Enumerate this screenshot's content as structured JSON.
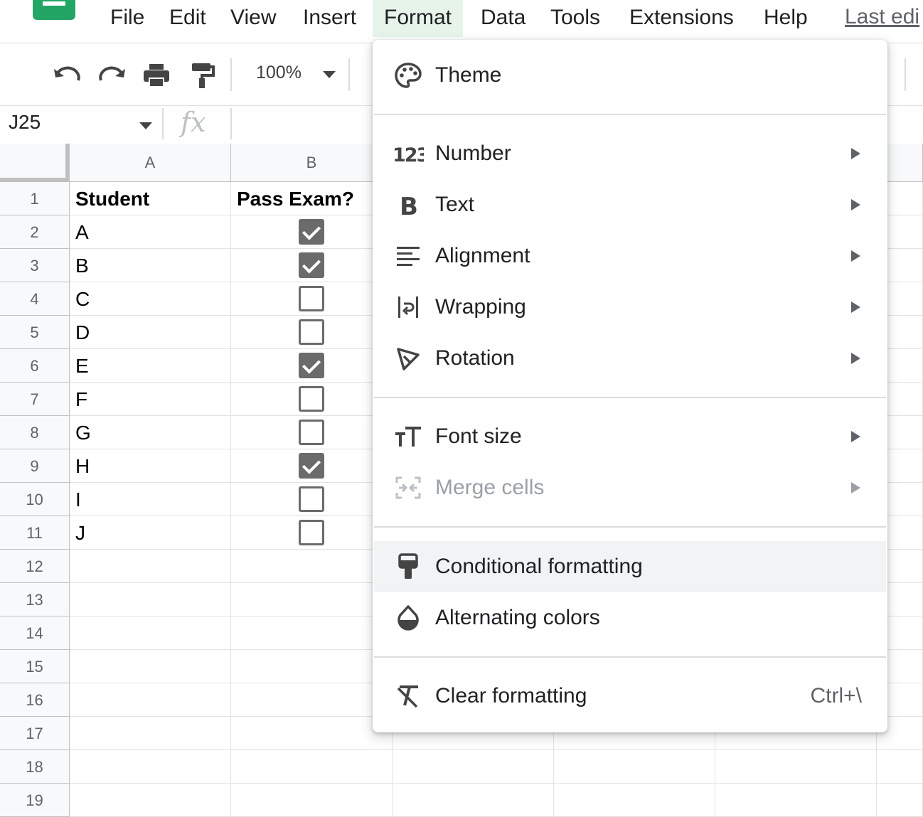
{
  "menubar": {
    "items": [
      "File",
      "Edit",
      "View",
      "Insert",
      "Format",
      "Data",
      "Tools",
      "Extensions",
      "Help"
    ],
    "active": "Format",
    "last_edit": "Last edi"
  },
  "toolbar": {
    "zoom": "100%",
    "icons": [
      "undo-icon",
      "redo-icon",
      "print-icon",
      "paint-format-icon",
      "chevron-down-icon"
    ]
  },
  "formula_bar": {
    "cell_ref": "J25",
    "fx_label": "fx",
    "value": ""
  },
  "sheet": {
    "columns": [
      "A",
      "B"
    ],
    "row_numbers": [
      "1",
      "2",
      "3",
      "4",
      "5",
      "6",
      "7",
      "8",
      "9",
      "10",
      "11",
      "12",
      "13",
      "14",
      "15",
      "16",
      "17",
      "18",
      "19"
    ],
    "header_row": [
      "Student",
      "Pass Exam?"
    ],
    "rows": [
      {
        "student": "A",
        "pass": true
      },
      {
        "student": "B",
        "pass": true
      },
      {
        "student": "C",
        "pass": false
      },
      {
        "student": "D",
        "pass": false
      },
      {
        "student": "E",
        "pass": true
      },
      {
        "student": "F",
        "pass": false
      },
      {
        "student": "G",
        "pass": false
      },
      {
        "student": "H",
        "pass": true
      },
      {
        "student": "I",
        "pass": false
      },
      {
        "student": "J",
        "pass": false
      }
    ]
  },
  "format_menu": {
    "items": [
      {
        "label": "Theme",
        "icon": "palette-icon",
        "submenu": false
      },
      {
        "label": "Number",
        "icon": "number-123-icon",
        "submenu": true
      },
      {
        "label": "Text",
        "icon": "bold-icon",
        "submenu": true
      },
      {
        "label": "Alignment",
        "icon": "align-left-icon",
        "submenu": true
      },
      {
        "label": "Wrapping",
        "icon": "wrap-icon",
        "submenu": true
      },
      {
        "label": "Rotation",
        "icon": "rotation-icon",
        "submenu": true
      },
      {
        "label": "Font size",
        "icon": "font-size-icon",
        "submenu": true
      },
      {
        "label": "Merge cells",
        "icon": "merge-cells-icon",
        "submenu": true,
        "disabled": true
      },
      {
        "label": "Conditional formatting",
        "icon": "conditional-formatting-icon",
        "submenu": false,
        "highlighted": true
      },
      {
        "label": "Alternating colors",
        "icon": "drop-icon",
        "submenu": false
      },
      {
        "label": "Clear formatting",
        "icon": "clear-formatting-icon",
        "submenu": false,
        "shortcut": "Ctrl+\\"
      }
    ]
  },
  "colors": {
    "sheets_green": "#23a566",
    "active_menu_bg": "#e6f4ea",
    "checkbox": "#6b6b6b",
    "menu_highlight": "#f1f3f4"
  }
}
